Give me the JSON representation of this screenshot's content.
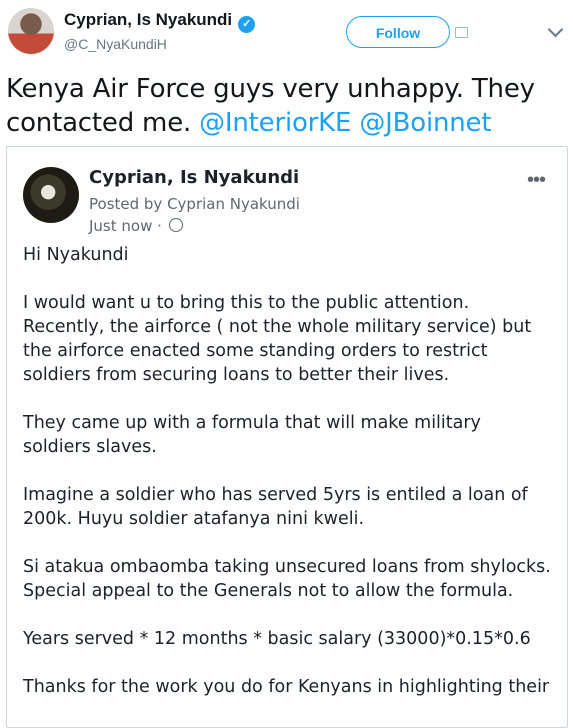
{
  "tweet": {
    "author_name": "Cyprian, Is Nyakundi",
    "handle": "@C_NyaKundiH",
    "follow_label": "Follow",
    "text_plain": "Kenya Air Force guys very unhappy. They contacted me. ",
    "mention1": "@InteriorKE",
    "mention2": "@JBoinnet"
  },
  "embedded_post": {
    "author_name": "Cyprian, Is  Nyakundi",
    "posted_by": "Posted by Cyprian Nyakundi",
    "time": "Just now",
    "more": "•••",
    "paragraphs": [
      "Hi Nyakundi",
      "I  would want u to bring this to the public attention. Recently, the airforce ( not the whole military service) but the airforce enacted some standing orders to restrict soldiers from securing loans to better their lives.",
      "They came up with a formula that will make military soldiers slaves.",
      "Imagine a soldier who has served 5yrs is entiled a loan of 200k. Huyu soldier atafanya nini kweli.",
      "Si atakua ombaomba taking unsecured loans from shylocks. Special appeal to the Generals not to allow the formula.",
      "Years served * 12 months * basic salary (33000)*0.15*0.6",
      "Thanks for the work you do for Kenyans in highlighting their"
    ]
  },
  "icons": [
    "verified-badge-icon",
    "add-follow-icon",
    "chevron-down-icon",
    "globe-icon",
    "more-options-icon"
  ],
  "colors": {
    "accent": "#1da1f2",
    "text": "#14171a",
    "muted": "#657786"
  }
}
